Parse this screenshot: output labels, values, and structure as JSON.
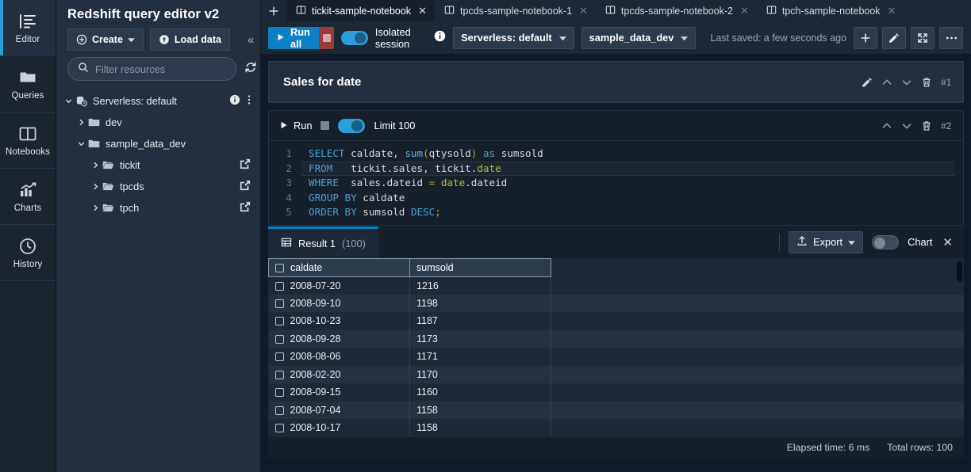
{
  "rail": {
    "items": [
      {
        "label": "Editor",
        "icon": "editor-icon",
        "active": true
      },
      {
        "label": "Queries",
        "icon": "folder-icon",
        "active": false
      },
      {
        "label": "Notebooks",
        "icon": "book-icon",
        "active": false
      },
      {
        "label": "Charts",
        "icon": "chart-icon",
        "active": false
      },
      {
        "label": "History",
        "icon": "clock-icon",
        "active": false
      }
    ]
  },
  "sidebar": {
    "title": "Redshift query editor v2",
    "create_label": "Create",
    "load_data_label": "Load data",
    "collapse_label": "«",
    "filter_placeholder": "Filter resources",
    "tree": [
      {
        "label": "Serverless: default",
        "level": 0,
        "expanded": true,
        "icon": "cluster-icon"
      },
      {
        "label": "dev",
        "level": 1,
        "expanded": false,
        "icon": "folder-icon"
      },
      {
        "label": "sample_data_dev",
        "level": 1,
        "expanded": true,
        "icon": "folder-icon"
      },
      {
        "label": "tickit",
        "level": 2,
        "expanded": false,
        "icon": "folder-open-icon"
      },
      {
        "label": "tpcds",
        "level": 2,
        "expanded": false,
        "icon": "folder-open-icon"
      },
      {
        "label": "tpch",
        "level": 2,
        "expanded": false,
        "icon": "folder-open-icon"
      }
    ]
  },
  "tabs": [
    {
      "label": "tickit-sample-notebook",
      "active": true
    },
    {
      "label": "tpcds-sample-notebook-1",
      "active": false
    },
    {
      "label": "tpcds-sample-notebook-2",
      "active": false
    },
    {
      "label": "tpch-sample-notebook",
      "active": false
    }
  ],
  "toolbar": {
    "run_all_label": "Run all",
    "isolated_session_label": "Isolated session",
    "isolated_session_on": true,
    "connection": "Serverless: default",
    "database": "sample_data_dev",
    "last_saved": "Last saved: a few seconds ago"
  },
  "cells": [
    {
      "type": "markdown",
      "title": "Sales for date",
      "number": "#1"
    },
    {
      "type": "sql",
      "number": "#2",
      "run_label": "Run",
      "limit_label": "Limit 100",
      "limit_on": true,
      "code": [
        [
          {
            "t": "SELECT",
            "c": "k"
          },
          {
            "t": " caldate, ",
            "c": "id"
          },
          {
            "t": "sum",
            "c": "f"
          },
          {
            "t": "(",
            "c": "p"
          },
          {
            "t": "qtysold",
            "c": "id"
          },
          {
            "t": ")",
            "c": "p"
          },
          {
            "t": " ",
            "c": "id"
          },
          {
            "t": "as",
            "c": "k"
          },
          {
            "t": " sumsold",
            "c": "id"
          }
        ],
        [
          {
            "t": "FROM",
            "c": "k"
          },
          {
            "t": "   tickit.sales, tickit.",
            "c": "id"
          },
          {
            "t": "date",
            "c": "y"
          }
        ],
        [
          {
            "t": "WHERE",
            "c": "k"
          },
          {
            "t": "  sales.dateid ",
            "c": "id"
          },
          {
            "t": "=",
            "c": "op"
          },
          {
            "t": " ",
            "c": "id"
          },
          {
            "t": "date",
            "c": "y"
          },
          {
            "t": ".dateid",
            "c": "id"
          }
        ],
        [
          {
            "t": "GROUP",
            "c": "k"
          },
          {
            "t": " ",
            "c": "id"
          },
          {
            "t": "BY",
            "c": "k"
          },
          {
            "t": " caldate",
            "c": "id"
          }
        ],
        [
          {
            "t": "ORDER",
            "c": "k"
          },
          {
            "t": " ",
            "c": "id"
          },
          {
            "t": "BY",
            "c": "k"
          },
          {
            "t": " sumsold ",
            "c": "id"
          },
          {
            "t": "DESC",
            "c": "k"
          },
          {
            "t": ";",
            "c": "p"
          }
        ]
      ],
      "line_numbers": [
        "1",
        "2",
        "3",
        "4",
        "5"
      ],
      "current_line": 2
    }
  ],
  "results": {
    "tab_label": "Result 1",
    "tab_count": "(100)",
    "export_label": "Export",
    "chart_label": "Chart",
    "chart_on": false,
    "columns": [
      "caldate",
      "sumsold"
    ],
    "rows": [
      [
        "2008-07-20",
        "1216"
      ],
      [
        "2008-09-10",
        "1198"
      ],
      [
        "2008-10-23",
        "1187"
      ],
      [
        "2008-09-28",
        "1173"
      ],
      [
        "2008-08-06",
        "1171"
      ],
      [
        "2008-02-20",
        "1170"
      ],
      [
        "2008-09-15",
        "1160"
      ],
      [
        "2008-07-04",
        "1158"
      ],
      [
        "2008-10-17",
        "1158"
      ]
    ],
    "elapsed_time": "Elapsed time: 6 ms",
    "total_rows": "Total rows: 100"
  },
  "colors": {
    "accent": "#0d7fc4",
    "toggle_on": "#2a9fd8",
    "stop_red": "#9c3a3a",
    "sidebar_bg": "#232f3e",
    "rail_bg": "#1b2530",
    "editor_bg": "#16202b"
  }
}
